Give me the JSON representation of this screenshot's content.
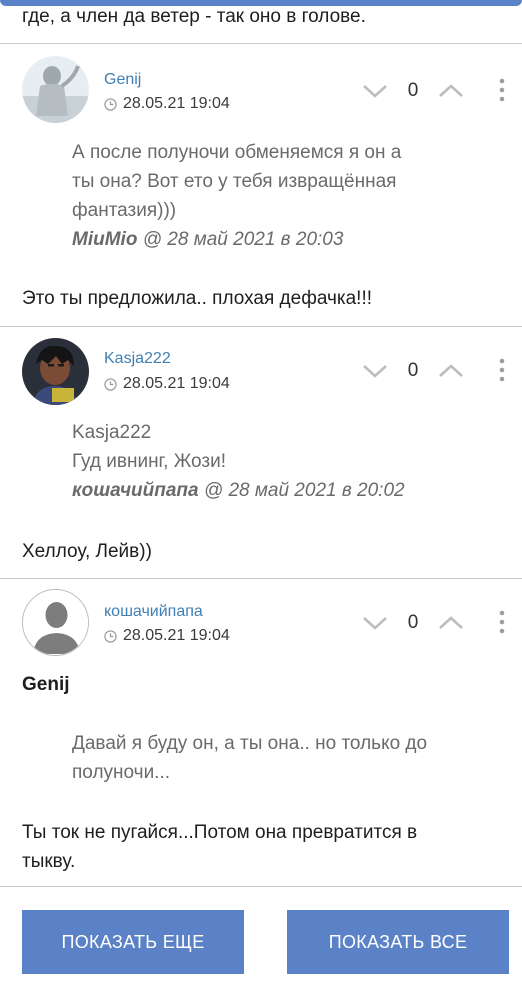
{
  "prev_comment": {
    "tail": "где, а член да ветер - так оно в голове."
  },
  "comments": [
    {
      "author": "Genij",
      "date": "28.05.21 19:04",
      "score": "0",
      "quote_lines": [
        "А после полуночи обменяемся я он а",
        "ты она? Вот ето у тебя извращённая",
        "фантазия)))"
      ],
      "quote_author": "MiuMio",
      "quote_date": "@ 28 май 2021 в 20:03",
      "text": "Это ты предложила.. плохая дефачка!!!"
    },
    {
      "author": "Kasja222",
      "date": "28.05.21 19:04",
      "score": "0",
      "quote_lines": [
        "Kasja222",
        "Гуд ивнинг, Жози!"
      ],
      "quote_author": "кошачийпапа",
      "quote_date": "@ 28 май 2021 в 20:02",
      "text": "Хеллоу, Лейв))"
    },
    {
      "author": "кошачийпапа",
      "date": "28.05.21 19:04",
      "score": "0",
      "label": "Genij",
      "quote_lines": [
        "Давай я буду он, а ты она.. но только до",
        "полуночи..."
      ],
      "text_lines": [
        "Ты ток не пугайся...Потом она превратится в",
        "тыкву."
      ]
    }
  ],
  "buttons": {
    "show_more": "ПОКАЗАТЬ ЕЩЕ",
    "show_all": "ПОКАЗАТЬ ВСЕ"
  },
  "colors": {
    "accent": "#5b82c6",
    "link": "#3f7fb3",
    "quote": "#6a6a6a"
  }
}
